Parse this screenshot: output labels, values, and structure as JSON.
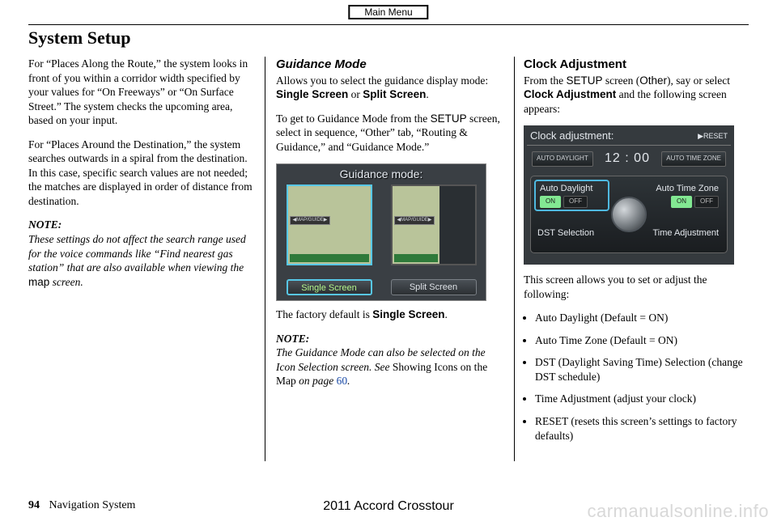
{
  "main_menu": "Main Menu",
  "page_title": "System Setup",
  "col1": {
    "p1": "For “Places Along the Route,” the system looks in front of you within a corridor width specified by your values for “On Freeways” or “On Surface Street.” The system checks the upcoming area, based on your input.",
    "p2": "For “Places Around the Destination,” the system searches outwards in a spiral from the destination. In this case, specific search values are not needed; the matches are displayed in order of distance from destination.",
    "note_label": "NOTE:",
    "note_body_a": "These settings do not affect the search range used for the voice commands like “Find nearest gas station” that are also available when viewing the ",
    "note_map": "map",
    "note_body_b": " screen."
  },
  "col2": {
    "heading": "Guidance Mode",
    "p1a": "Allows you to select the guidance display mode: ",
    "p1b_single": "Single Screen",
    "p1c": " or ",
    "p1d_split": "Split Screen",
    "p1e": ".",
    "p2a": "To get to Guidance Mode from the ",
    "p2_setup": "SETUP",
    "p2b": " screen, select in sequence, “Other” tab, “Routing & Guidance,” and “Guidance Mode.”",
    "fig": {
      "title": "Guidance mode:",
      "mapguide": "◀MAP/GUIDE▶",
      "btn_single": "Single Screen",
      "btn_split": "Split Screen"
    },
    "caption_a": "The factory default is ",
    "caption_b": "Single Screen",
    "caption_c": ".",
    "note_label": "NOTE:",
    "note_body_a": "The Guidance Mode can also be selected on the Icon Selection screen. See ",
    "note_ref": "Showing Icons on the Map",
    "note_body_b": " on page ",
    "note_page": "60",
    "note_body_c": "."
  },
  "col3": {
    "heading": "Clock Adjustment",
    "p1a": "From the ",
    "p1_setup": "SETUP",
    "p1b": " screen (",
    "p1_other": "Other",
    "p1c": "), say or select ",
    "p1_clock": "Clock Adjustment",
    "p1d": " and the following screen appears:",
    "fig": {
      "title": "Clock adjustment:",
      "reset": "▶RESET",
      "chip_daylight": "AUTO DAYLIGHT",
      "time": "12 : 00",
      "chip_tz": "AUTO TIME ZONE",
      "auto_daylight": "Auto Daylight",
      "auto_tz": "Auto Time Zone",
      "dst": "DST Selection",
      "time_adj": "Time Adjustment",
      "on": "ON",
      "off": "OFF"
    },
    "p2": "This screen allows you to set or adjust the following:",
    "bullets": [
      "Auto Daylight (Default = ON)",
      "Auto Time Zone (Default = ON)",
      "DST (Daylight Saving Time) Selection (change DST schedule)",
      "Time Adjustment (adjust your clock)",
      "RESET (resets this screen’s settings to factory defaults)"
    ]
  },
  "footer": {
    "page": "94",
    "label": "Navigation System",
    "center": "2011 Accord Crosstour"
  },
  "watermark": "carmanualsonline.info"
}
